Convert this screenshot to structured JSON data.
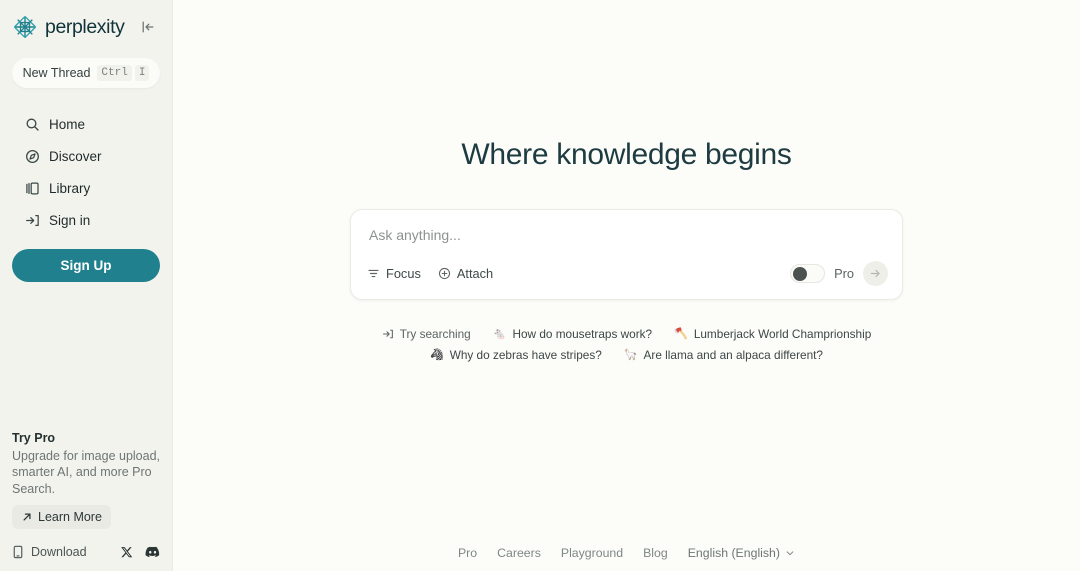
{
  "brand": {
    "name": "perplexity",
    "logo_icon": "perplexity-snowflake-logo",
    "collapse_icon": "collapse-sidebar-icon",
    "accent_color": "#20808d"
  },
  "sidebar": {
    "new_thread": {
      "label": "New Thread",
      "shortcut_keys": [
        "Ctrl",
        "I"
      ]
    },
    "nav_items": [
      {
        "label": "Home",
        "icon": "search-icon"
      },
      {
        "label": "Discover",
        "icon": "compass-icon"
      },
      {
        "label": "Library",
        "icon": "library-icon"
      },
      {
        "label": "Sign in",
        "icon": "sign-in-icon"
      }
    ],
    "signup_label": "Sign Up",
    "try_pro": {
      "title": "Try Pro",
      "description": "Upgrade for image upload, smarter AI, and more Pro Search.",
      "learn_more_label": "Learn More",
      "learn_more_icon": "arrow-up-right-icon"
    },
    "bottom": {
      "download_label": "Download",
      "download_icon": "mobile-phone-icon",
      "socials": [
        {
          "name": "x-twitter-icon"
        },
        {
          "name": "discord-icon"
        }
      ]
    }
  },
  "main": {
    "hero_title": "Where knowledge begins",
    "search": {
      "placeholder": "Ask anything...",
      "value": "",
      "focus_label": "Focus",
      "focus_icon": "filter-icon",
      "attach_label": "Attach",
      "attach_icon": "circle-plus-icon",
      "pro_label": "Pro",
      "pro_enabled": false,
      "submit_icon": "arrow-right-icon"
    },
    "suggestions": {
      "prompt_label": "Try searching",
      "prompt_icon": "arrow-into-bracket-icon",
      "row1": [
        {
          "emoji": "🐁",
          "label": "How do mousetraps work?"
        },
        {
          "emoji": "🪓",
          "label": "Lumberjack World Champrionship"
        }
      ],
      "row2": [
        {
          "emoji": "🦓",
          "label": "Why do zebras have stripes?"
        },
        {
          "emoji": "🦙",
          "label": "Are llama and an alpaca different?"
        }
      ]
    }
  },
  "footer": {
    "links": [
      "Pro",
      "Careers",
      "Playground",
      "Blog"
    ],
    "language": "English (English)",
    "language_chevron_icon": "chevron-down-icon"
  }
}
